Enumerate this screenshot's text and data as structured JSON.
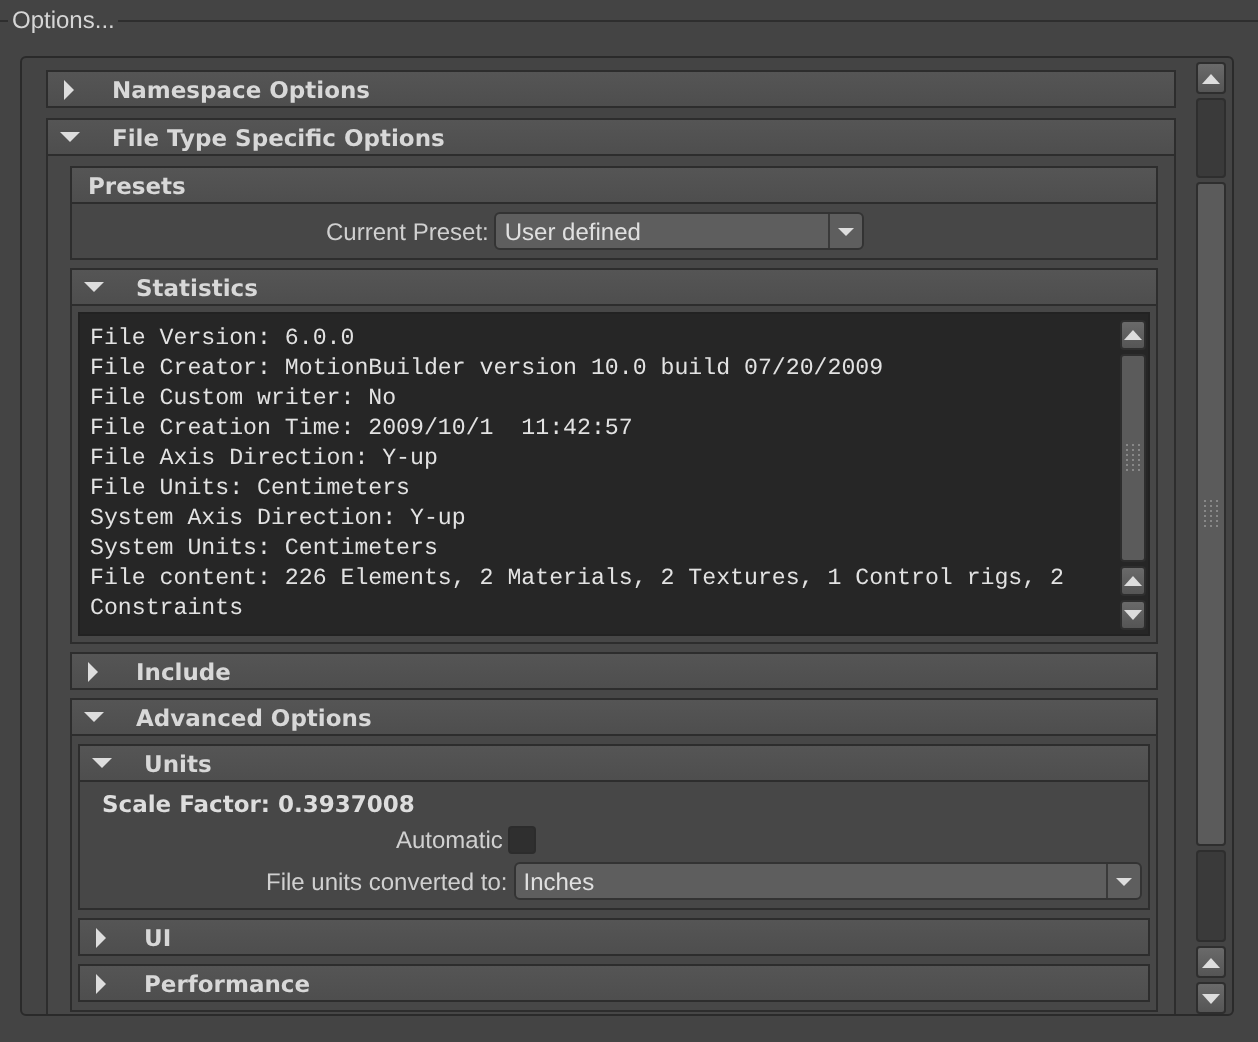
{
  "group_title": "Options...",
  "sections": [
    {
      "kind": "section",
      "title": "Namespace Options",
      "expanded": false
    },
    {
      "kind": "section",
      "title": "File Type Specific Options",
      "expanded": true,
      "children": [
        {
          "kind": "panel",
          "title": "Presets",
          "content": [
            {
              "kind": "selector",
              "label": "Current Preset:",
              "value": "User defined"
            }
          ]
        },
        {
          "kind": "section",
          "title": "Statistics",
          "expanded": true,
          "content": [
            {
              "kind": "log",
              "lines": [
                "File Version: 6.0.0",
                "File Creator: MotionBuilder version 10.0 build 07/20/2009",
                "File Custom writer: No",
                "File Creation Time: 2009/10/1  11:42:57",
                "File Axis Direction: Y-up",
                "File Units: Centimeters",
                "System Axis Direction: Y-up",
                "System Units: Centimeters",
                "File content: 226 Elements, 2 Materials, 2 Textures, 1 Control rigs, 2 Constraints"
              ]
            }
          ]
        },
        {
          "kind": "section",
          "title": "Include",
          "expanded": false
        },
        {
          "kind": "section",
          "title": "Advanced Options",
          "expanded": true,
          "children": [
            {
              "kind": "section",
              "title": "Units",
              "expanded": true,
              "content": [
                {
                  "kind": "heading",
                  "text": "Scale Factor: 0.3937008"
                },
                {
                  "kind": "checkbox",
                  "label": "Automatic",
                  "checked": false
                },
                {
                  "kind": "dropdown",
                  "label": "File units converted to:",
                  "value": "Inches"
                }
              ]
            },
            {
              "kind": "section",
              "title": "UI",
              "expanded": false
            },
            {
              "kind": "section",
              "title": "Performance",
              "expanded": false
            }
          ]
        }
      ]
    }
  ]
}
